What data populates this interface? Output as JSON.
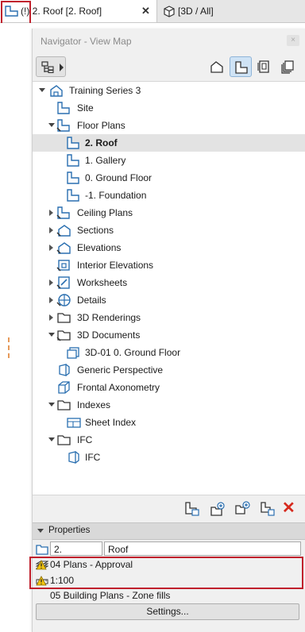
{
  "tabs": [
    {
      "label": "(!) 2. Roof [2. Roof]",
      "icon": "floor-plan-icon",
      "close": "✕"
    },
    {
      "label": "[3D / All]",
      "icon": "3d-view-icon"
    }
  ],
  "navigator": {
    "title": "Navigator - View Map",
    "close_label": "×",
    "map_buttons": [
      "project-map-icon",
      "view-map-icon",
      "layout-book-icon",
      "publisher-sets-icon"
    ],
    "active_map_button": 1
  },
  "tree": {
    "root": "Training Series 3",
    "site": "Site",
    "floor_plans": "Floor Plans",
    "floors": [
      "2. Roof",
      "1. Gallery",
      "0. Ground Floor",
      "-1. Foundation"
    ],
    "ceiling_plans": "Ceiling Plans",
    "sections": "Sections",
    "elevations": "Elevations",
    "interior_elevations": "Interior Elevations",
    "worksheets": "Worksheets",
    "details": "Details",
    "renderings": "3D Renderings",
    "documents": "3D Documents",
    "doc_item": "3D-01 0. Ground Floor",
    "generic_perspective": "Generic Perspective",
    "frontal_axonometry": "Frontal Axonometry",
    "indexes": "Indexes",
    "sheet_index": "Sheet Index",
    "ifc": "IFC",
    "ifc_item": "IFC"
  },
  "actions": {
    "icons": [
      "new-view-icon",
      "new-folder-icon",
      "new-clone-folder-icon",
      "view-settings-icon"
    ],
    "delete": "✕",
    "accent": "#d62a1e"
  },
  "properties": {
    "header": "Properties",
    "id_value": "2.",
    "name_value": "Roof",
    "layer_combination": "04 Plans - Approval",
    "scale": "1:100",
    "partial_row": "05 Building Plans - Zone fills",
    "settings_label": "Settings..."
  },
  "colors": {
    "highlight_box": "#c0202c",
    "selected_row": "#e3e3e3",
    "active_button": "#cfe3f5",
    "warning": "#f2c40f"
  }
}
